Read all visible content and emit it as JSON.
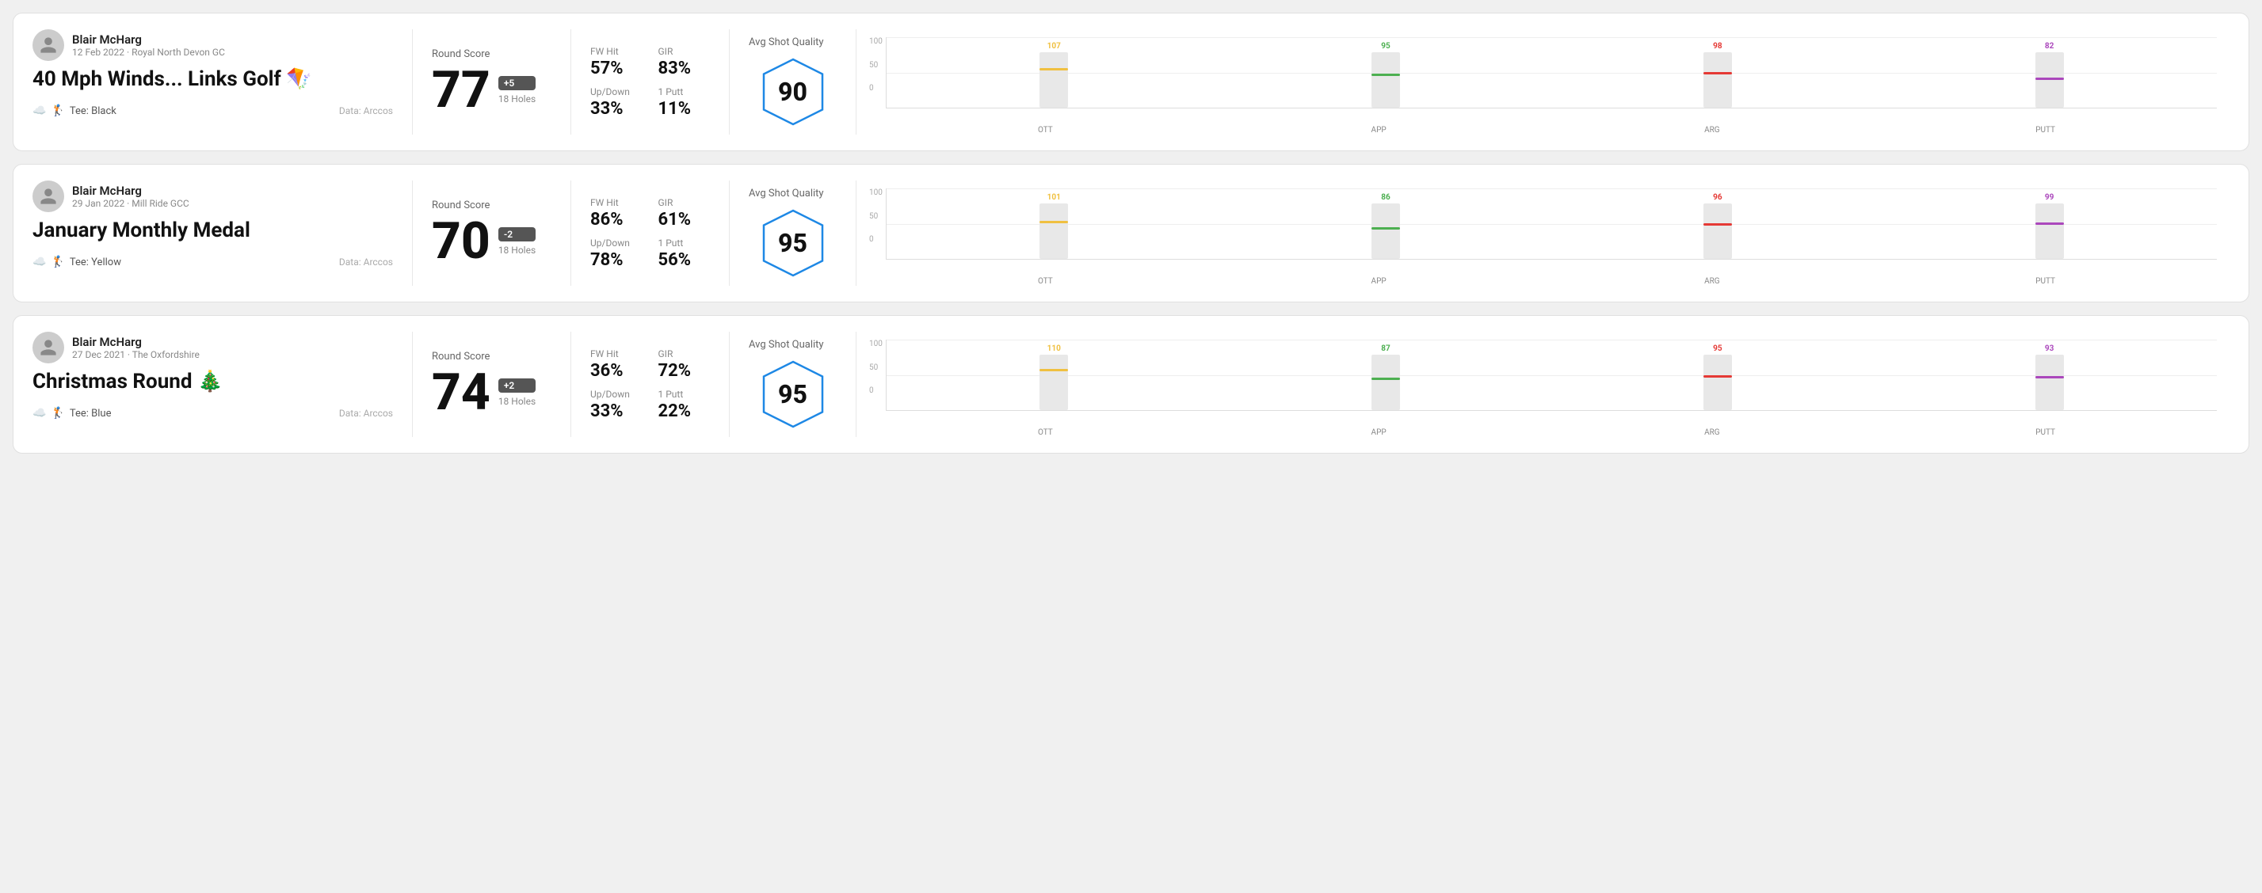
{
  "rounds": [
    {
      "id": "round1",
      "user": {
        "name": "Blair McHarg",
        "meta": "12 Feb 2022 · Royal North Devon GC"
      },
      "title": "40 Mph Winds... Links Golf 🪁",
      "tee": "Black",
      "data_source": "Data: Arccos",
      "score": "77",
      "score_modifier": "+5",
      "holes": "18 Holes",
      "stats": {
        "fw_hit": "57%",
        "gir": "83%",
        "up_down": "33%",
        "one_putt": "11%"
      },
      "avg_shot_quality": "90",
      "chart": {
        "ott": {
          "value": 107,
          "color": "#f0c040",
          "bar_height_pct": 72
        },
        "app": {
          "value": 95,
          "color": "#4caf50",
          "bar_height_pct": 62
        },
        "arg": {
          "value": 98,
          "color": "#e53935",
          "bar_height_pct": 65
        },
        "putt": {
          "value": 82,
          "color": "#ab47bc",
          "bar_height_pct": 55
        }
      }
    },
    {
      "id": "round2",
      "user": {
        "name": "Blair McHarg",
        "meta": "29 Jan 2022 · Mill Ride GCC"
      },
      "title": "January Monthly Medal",
      "tee": "Yellow",
      "data_source": "Data: Arccos",
      "score": "70",
      "score_modifier": "-2",
      "holes": "18 Holes",
      "stats": {
        "fw_hit": "86%",
        "gir": "61%",
        "up_down": "78%",
        "one_putt": "56%"
      },
      "avg_shot_quality": "95",
      "chart": {
        "ott": {
          "value": 101,
          "color": "#f0c040",
          "bar_height_pct": 68
        },
        "app": {
          "value": 86,
          "color": "#4caf50",
          "bar_height_pct": 57
        },
        "arg": {
          "value": 96,
          "color": "#e53935",
          "bar_height_pct": 64
        },
        "putt": {
          "value": 99,
          "color": "#ab47bc",
          "bar_height_pct": 66
        }
      }
    },
    {
      "id": "round3",
      "user": {
        "name": "Blair McHarg",
        "meta": "27 Dec 2021 · The Oxfordshire"
      },
      "title": "Christmas Round 🎄",
      "tee": "Blue",
      "data_source": "Data: Arccos",
      "score": "74",
      "score_modifier": "+2",
      "holes": "18 Holes",
      "stats": {
        "fw_hit": "36%",
        "gir": "72%",
        "up_down": "33%",
        "one_putt": "22%"
      },
      "avg_shot_quality": "95",
      "chart": {
        "ott": {
          "value": 110,
          "color": "#f0c040",
          "bar_height_pct": 74
        },
        "app": {
          "value": 87,
          "color": "#4caf50",
          "bar_height_pct": 58
        },
        "arg": {
          "value": 95,
          "color": "#e53935",
          "bar_height_pct": 63
        },
        "putt": {
          "value": 93,
          "color": "#ab47bc",
          "bar_height_pct": 62
        }
      }
    }
  ],
  "labels": {
    "round_score": "Round Score",
    "avg_shot_quality": "Avg Shot Quality",
    "fw_hit": "FW Hit",
    "gir": "GIR",
    "up_down": "Up/Down",
    "one_putt": "1 Putt",
    "ott": "OTT",
    "app": "APP",
    "arg": "ARG",
    "putt": "PUTT",
    "tee_prefix": "Tee:",
    "y_100": "100",
    "y_50": "50",
    "y_0": "0"
  }
}
